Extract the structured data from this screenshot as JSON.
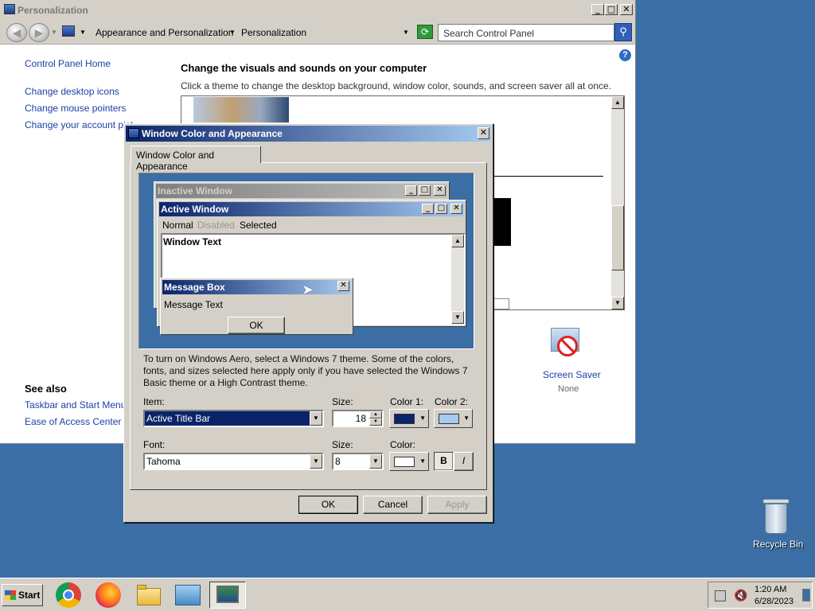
{
  "window": {
    "title": "Personalization",
    "caption_buttons": {
      "minimize": "_",
      "maximize": "□",
      "close": "✕"
    }
  },
  "address_bar": {
    "crumb1": "Appearance and Personalization",
    "crumb2": "Personalization",
    "search_placeholder": "Search Control Panel"
  },
  "sidebar": {
    "home": "Control Panel Home",
    "links": [
      "Change desktop icons",
      "Change mouse pointers",
      "Change your account pict"
    ],
    "see_also_title": "See also",
    "see_also": [
      "Taskbar and Start Menu",
      "Ease of Access Center"
    ]
  },
  "main": {
    "heading": "Change the visuals and sounds on your computer",
    "subtitle": "Click a theme to change the desktop background, window color, sounds, and screen saver all at once.",
    "screen_saver_label": "Screen Saver",
    "screen_saver_value": "None"
  },
  "dialog": {
    "title": "Window Color and Appearance",
    "tab": "Window Color and Appearance",
    "preview": {
      "inactive_title": "Inactive Window",
      "active_title": "Active Window",
      "menu": [
        "Normal",
        "Disabled",
        "Selected"
      ],
      "window_text": "Window Text",
      "msgbox_title": "Message Box",
      "msgbox_text": "Message Text",
      "msgbox_ok": "OK"
    },
    "info": "To turn on Windows Aero, select a Windows 7 theme.  Some of the colors, fonts, and sizes selected here apply only if you have selected the Windows 7 Basic theme or a High Contrast theme.",
    "item_label": "Item:",
    "item_value": "Active Title Bar",
    "item_size_label": "Size:",
    "item_size_value": "18",
    "color1_label": "Color 1:",
    "color2_label": "Color 2:",
    "color1": "#0a246a",
    "color2": "#a6caf0",
    "font_label": "Font:",
    "font_value": "Tahoma",
    "font_size_label": "Size:",
    "font_size_value": "8",
    "font_color_label": "Color:",
    "font_color": "#ffffff",
    "bold_label": "B",
    "italic_label": "I",
    "ok": "OK",
    "cancel": "Cancel",
    "apply": "Apply"
  },
  "desktop": {
    "recycle_bin": "Recycle Bin"
  },
  "taskbar": {
    "start": "Start",
    "time": "1:20 AM",
    "date": "6/28/2023",
    "apps": [
      "chrome-icon",
      "firefox-icon",
      "explorer-icon",
      "control-panel-icon",
      "personalization-icon"
    ]
  }
}
